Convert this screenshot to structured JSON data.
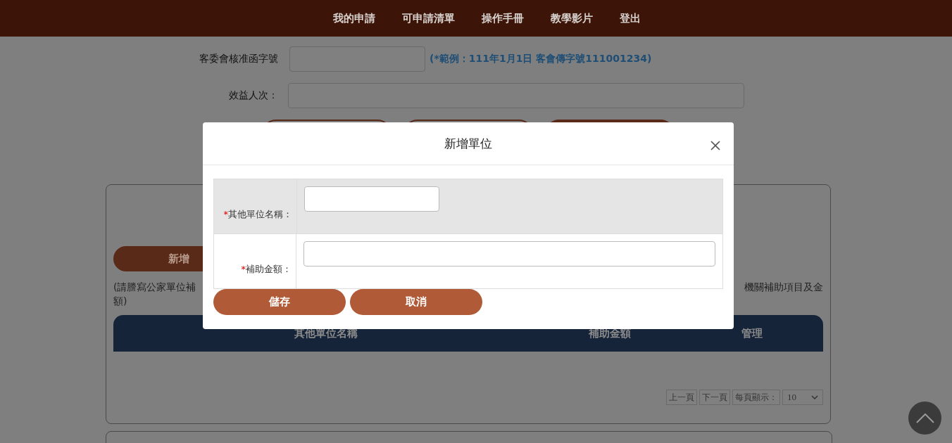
{
  "nav": {
    "links": [
      "我的申請",
      "可申請清單",
      "操作手冊",
      "教學影片",
      "登出"
    ]
  },
  "form": {
    "fields": [
      {
        "label": "客委會核准函字號",
        "kind": "short",
        "hint": "(*範例：111年1月1日 客會傳字號111001234)"
      },
      {
        "label": "效益人次：",
        "kind": "long"
      }
    ]
  },
  "panel": {
    "add_button": "新增",
    "note_start": "(請謄寫公家單位補",
    "note_end": "機關補助項目及金",
    "note_wrap": "額)",
    "table": {
      "columns": [
        "其他單位名稱",
        "補助金額",
        "管理"
      ]
    },
    "pagination": {
      "prev": "上一頁",
      "next": "下一頁",
      "page_size_label": "每頁顯示：",
      "page_size": "10"
    }
  },
  "dialog": {
    "title": "新增單位",
    "fields": [
      {
        "mark": "*",
        "label": "其他單位名稱：",
        "kind": "short"
      },
      {
        "mark": "*",
        "label": "補助金額：",
        "kind": "long"
      }
    ],
    "buttons": [
      "儲存",
      "取消"
    ]
  }
}
